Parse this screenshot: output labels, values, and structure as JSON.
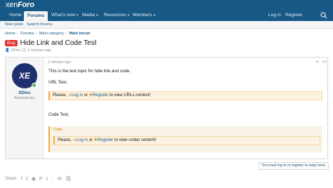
{
  "header": {
    "logo_left": "xen",
    "logo_right": "Foro",
    "login": "Log in",
    "register": "Register"
  },
  "nav": {
    "items": [
      "Home",
      "Forums",
      "What's new",
      "Media",
      "Resources",
      "Members"
    ]
  },
  "subnav": {
    "items": [
      "New posts",
      "Search forums"
    ]
  },
  "breadcrumb": {
    "items": [
      "Home",
      "Forums",
      "Main category",
      "Main forum"
    ]
  },
  "thread": {
    "prefix": "Bug",
    "title": "Hide Link and Code Test",
    "author": "XDinc",
    "date": "2 minutes ago"
  },
  "post": {
    "avatar_text": "XE",
    "username": "XDinc",
    "role": "Administrator",
    "date": "2 minutes ago",
    "number": "#1",
    "lines": {
      "intro": "This is the test topic for hide link and code.",
      "url": "URL Test,",
      "code": "Code Test,"
    },
    "notice": {
      "please": "Please,",
      "login": "Log in",
      "or": "or",
      "register": "Register",
      "url_tail": "to view URLs content!",
      "code_tail": "to view codes content!"
    },
    "code_label": "Code:"
  },
  "footer": {
    "share_label": "Share:",
    "must_login": "You must log in or register to reply here."
  },
  "colors": {
    "brand": "#185886",
    "badge": "#e03030",
    "notice_border": "#f0a93a"
  }
}
